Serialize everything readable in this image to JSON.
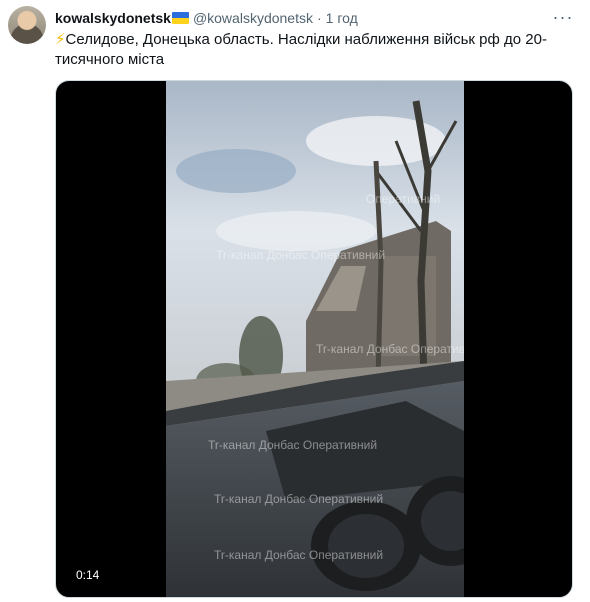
{
  "tweet": {
    "display_name": "kowalskydonetsk",
    "handle": "@kowalskydonetsk",
    "separator": "·",
    "time": "1 год",
    "more_icon": "more-horizontal-icon",
    "text_line1": "Селидове, Донецька область. Наслідки наближення військ рф до 20-",
    "text_line2": "тисячного міста",
    "text_emoji": "⚡"
  },
  "media": {
    "timestamp": "0:14",
    "watermark": "Tr-канал Донбас Оперативний",
    "watermark_short": "Оперативний"
  }
}
